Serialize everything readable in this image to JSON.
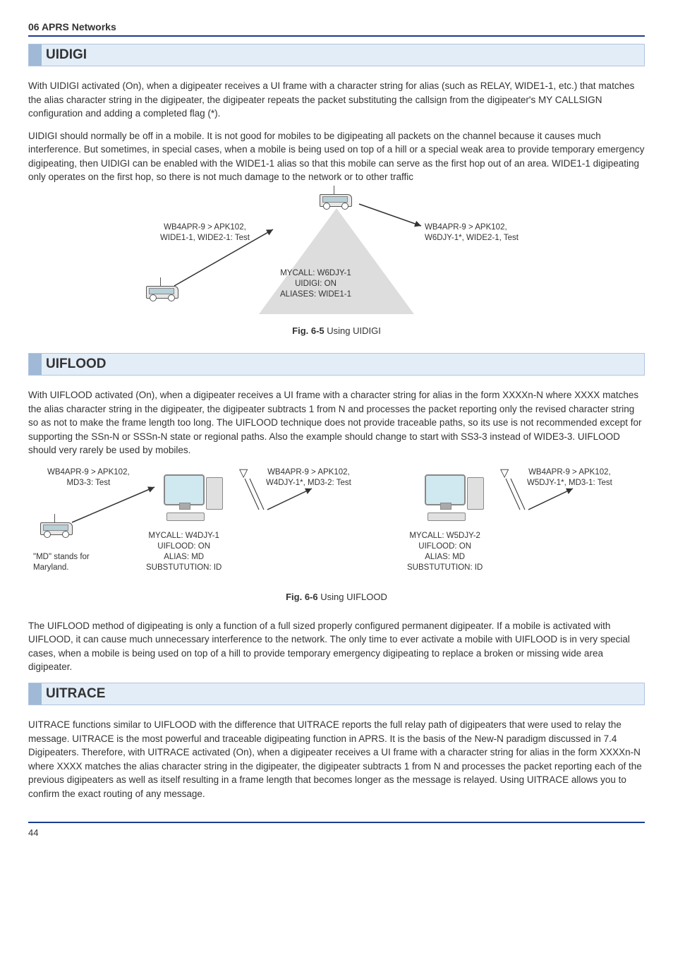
{
  "header": {
    "chapter": "06  APRS Networks"
  },
  "sections": {
    "uidigi": {
      "title": "UIDIGI",
      "p1": "With UIDIGI activated (On), when a digipeater receives a UI frame with a character string for alias (such as RELAY, WIDE1-1, etc.) that matches the alias character string in the digipeater, the digipeater repeats the packet substituting the callsign from the digipeater's MY CALLSIGN configuration and adding a completed flag (*).",
      "p2": "UIDIGI should normally be off in a mobile. It is not good for mobiles to be digipeating all packets on the channel because it causes much interference. But sometimes, in special cases, when a mobile is being used on top of a hill or a special weak area to provide temporary emergency digipeating, then UIDIGI can be enabled with the WIDE1-1 alias so that this mobile can serve as the first hop out of an area. WIDE1-1 digipeating only operates on the first hop, so there is not much damage to the network or to other traffic",
      "fig": {
        "left_label_l1": "WB4APR-9 > APK102,",
        "left_label_l2": "WIDE1-1, WIDE2-1: Test",
        "right_label_l1": "WB4APR-9 > APK102,",
        "right_label_l2": "W6DJY-1*, WIDE2-1, Test",
        "mountain_l1": "MYCALL: W6DJY-1",
        "mountain_l2": "UIDIGI: ON",
        "mountain_l3": "ALIASES: WIDE1-1",
        "caption_bold": "Fig. 6-5",
        "caption_text": " Using UIDIGI"
      }
    },
    "uiflood": {
      "title": "UIFLOOD",
      "p1": "With UIFLOOD activated (On), when a digipeater receives a UI frame with a character string for alias in the form XXXXn-N where XXXX matches the alias character string in the digipeater, the digipeater subtracts 1 from N and processes the packet reporting only the revised character string so as not to make the frame length too long. The UIFLOOD technique does not provide traceable paths, so its use is not recommended except for supporting the SSn-N or SSSn-N state or regional paths. Also the example should change to start with SS3-3 instead of WIDE3-3. UIFLOOD should very rarely be used by mobiles.",
      "fig": {
        "label1_l1": "WB4APR-9 > APK102,",
        "label1_l2": "MD3-3: Test",
        "label2_l1": "WB4APR-9 > APK102,",
        "label2_l2": "W4DJY-1*, MD3-2: Test",
        "label3_l1": "WB4APR-9 > APK102,",
        "label3_l2": "W5DJY-1*, MD3-1: Test",
        "pc1_l1": "MYCALL: W4DJY-1",
        "pc1_l2": "UIFLOOD: ON",
        "pc1_l3": "ALIAS: MD",
        "pc1_l4": "SUBSTUTUTION: ID",
        "pc2_l1": "MYCALL: W5DJY-2",
        "pc2_l2": "UIFLOOD: ON",
        "pc2_l3": "ALIAS: MD",
        "pc2_l4": "SUBSTUTUTION: ID",
        "note_l1": "\"MD\" stands for",
        "note_l2": "Maryland.",
        "caption_bold": "Fig. 6-6",
        "caption_text": " Using UIFLOOD"
      },
      "p2": "The UIFLOOD method of digipeating is only a function of a full sized properly configured permanent digipeater. If a mobile is activated with UIFLOOD, it can cause much unnecessary interference to the network. The only time to ever activate a mobile with UIFLOOD is in very special cases, when a mobile is being used on top of a hill to provide temporary emergency digipeating to replace a broken or missing wide area digipeater."
    },
    "uitrace": {
      "title": "UITRACE",
      "p1": "UITRACE functions similar to UIFLOOD with the difference that UITRACE reports the full relay path of digipeaters that were used to relay the message. UITRACE is the most powerful and traceable digipeating function in APRS. It is the basis of the New-N paradigm discussed in 7.4 Digipeaters. Therefore, with UITRACE activated (On), when a digipeater receives a UI frame with a character string for alias in the form XXXXn-N where XXXX matches the alias character string in the digipeater, the digipeater subtracts 1 from N and processes the packet reporting each of the previous digipeaters as well as itself resulting in a frame length that becomes longer as the message is relayed. Using UITRACE allows you to confirm the exact routing of any message."
    }
  },
  "page_number": "44"
}
